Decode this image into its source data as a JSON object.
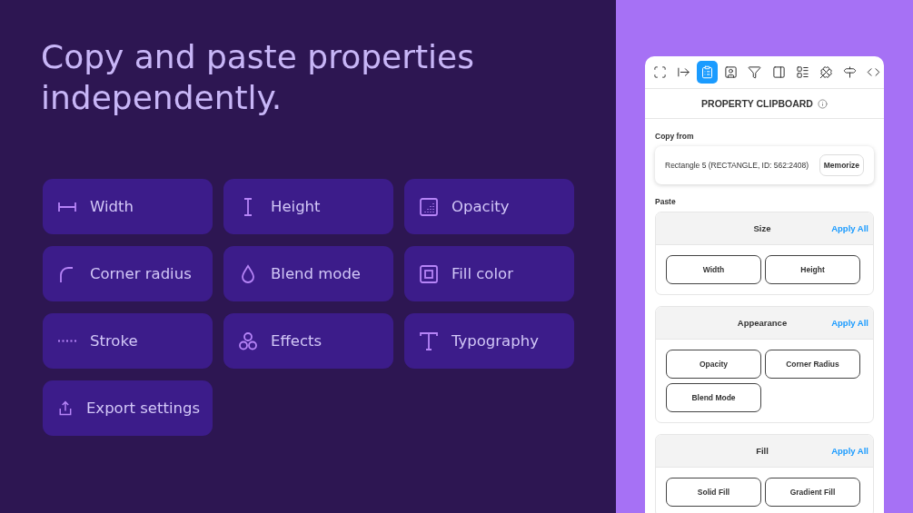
{
  "headline": "Copy and paste properties independently.",
  "features": [
    {
      "kind": "width",
      "label": "Width"
    },
    {
      "kind": "height",
      "label": "Height"
    },
    {
      "kind": "opacity",
      "label": "Opacity"
    },
    {
      "kind": "corner",
      "label": "Corner radius"
    },
    {
      "kind": "blend",
      "label": "Blend mode"
    },
    {
      "kind": "fill",
      "label": "Fill color"
    },
    {
      "kind": "stroke",
      "label": "Stroke"
    },
    {
      "kind": "effects",
      "label": "Effects"
    },
    {
      "kind": "type",
      "label": "Typography"
    },
    {
      "kind": "export",
      "label": "Export settings"
    }
  ],
  "plugin": {
    "toolbar": [
      {
        "kind": "scan",
        "selected": false
      },
      {
        "kind": "arrow",
        "selected": false
      },
      {
        "kind": "clipboard",
        "selected": true
      },
      {
        "kind": "user",
        "selected": false
      },
      {
        "kind": "filter",
        "selected": false
      },
      {
        "kind": "panel",
        "selected": false
      },
      {
        "kind": "list",
        "selected": false
      },
      {
        "kind": "clover",
        "selected": false
      },
      {
        "kind": "signpost",
        "selected": false
      },
      {
        "kind": "code",
        "selected": false
      }
    ],
    "title": "PROPERTY CLIPBOARD",
    "copy_from": {
      "label": "Copy from",
      "source": "Rectangle 5 (RECTANGLE, ID: 562:2408)",
      "button": "Memorize"
    },
    "paste_label": "Paste",
    "sections": [
      {
        "title": "Size",
        "apply": "Apply All",
        "buttons": [
          "Width",
          "Height"
        ]
      },
      {
        "title": "Appearance",
        "apply": "Apply All",
        "buttons": [
          "Opacity",
          "Corner Radius",
          "Blend Mode"
        ]
      },
      {
        "title": "Fill",
        "apply": "Apply All",
        "buttons": [
          "Solid Fill",
          "Gradient Fill"
        ]
      }
    ]
  }
}
